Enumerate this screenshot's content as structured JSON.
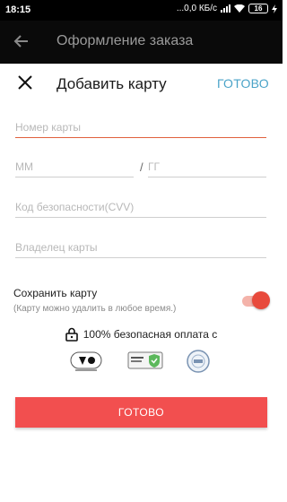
{
  "status_bar": {
    "time": "18:15",
    "network_speed": "...0,0 КБ/с",
    "battery": "16",
    "icons": [
      "signal-icon",
      "wifi-icon",
      "battery-icon",
      "charging-icon"
    ]
  },
  "app_bar": {
    "title": "Оформление заказа",
    "back_icon": "arrow-back-icon"
  },
  "dialog": {
    "title": "Добавить карту",
    "close_icon": "close-icon",
    "done_link": "ГОТОВО"
  },
  "form": {
    "card_number": {
      "placeholder": "Номер карты",
      "value": ""
    },
    "month": {
      "placeholder": "ММ",
      "value": ""
    },
    "separator": "/",
    "year": {
      "placeholder": "ГГ",
      "value": ""
    },
    "cvv": {
      "placeholder": "Код безопасности(CVV)",
      "value": ""
    },
    "holder": {
      "placeholder": "Владелец карты",
      "value": ""
    }
  },
  "save_card": {
    "label": "Сохранить карту",
    "hint": "(Карту можно удалить в любое время.)",
    "enabled": true
  },
  "security": {
    "text": "100% безопасная оплата с",
    "badges": [
      "pci-dss-badge",
      "ssl-secure-badge",
      "iso-certified-badge"
    ]
  },
  "submit_button": "ГОТОВО",
  "colors": {
    "accent": "#f24f4f",
    "link": "#4aa3c8",
    "active_underline": "#e0603d",
    "toggle_thumb": "#e84a3c"
  }
}
